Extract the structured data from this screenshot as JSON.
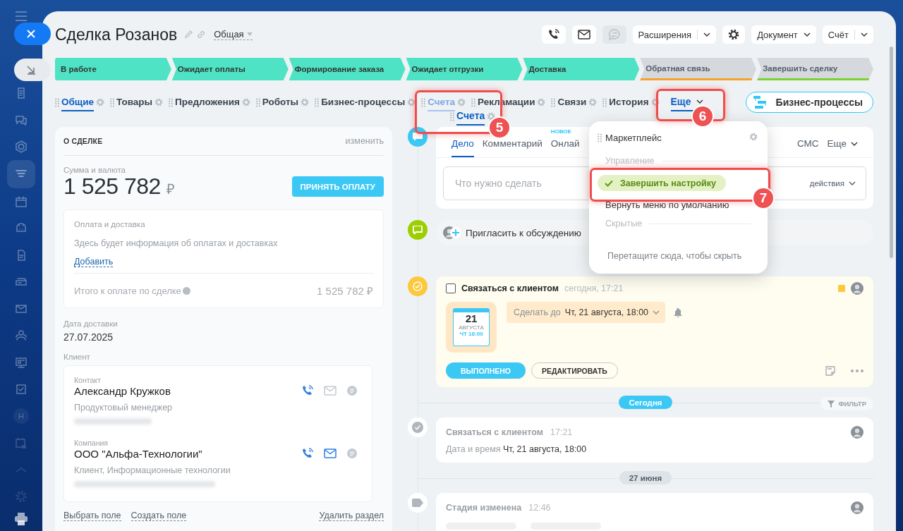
{
  "sidebar": {
    "badge": "H"
  },
  "title": "Сделка Розанов",
  "category": "Общая",
  "header_buttons": [
    {
      "kind": "phone",
      "disabled": false
    },
    {
      "kind": "mail",
      "disabled": false
    },
    {
      "kind": "chat",
      "disabled": true
    },
    {
      "kind": "split",
      "label": "Расширения",
      "disabled": false
    },
    {
      "kind": "settings",
      "disabled": false
    },
    {
      "kind": "dropdown",
      "label": "Документ",
      "disabled": false
    },
    {
      "kind": "split",
      "label": "Счёт",
      "disabled": false
    }
  ],
  "stages": [
    {
      "label": "В работе",
      "reached": true,
      "color": "#4ee3c4"
    },
    {
      "label": "Ожидает оплаты",
      "reached": true,
      "color": "#4ee3c4"
    },
    {
      "label": "Формирование заказа",
      "reached": true,
      "color": "#4ee3c4"
    },
    {
      "label": "Ожидает отгрузки",
      "reached": true,
      "color": "#4ee3c4"
    },
    {
      "label": "Доставка",
      "reached": true,
      "color": "#4ee3c4"
    },
    {
      "label": "Обратная связь",
      "reached": false,
      "color": "#f7a12b"
    },
    {
      "label": "Завершить сделку",
      "reached": false,
      "color": "#7bd12f"
    }
  ],
  "tabs": [
    {
      "label": "Общие",
      "selected": true,
      "dragging": false
    },
    {
      "label": "Товары",
      "selected": false,
      "dragging": false
    },
    {
      "label": "Предложения",
      "selected": false,
      "dragging": false
    },
    {
      "label": "Роботы",
      "selected": false,
      "dragging": false
    },
    {
      "label": "Бизнес-процессы",
      "selected": false,
      "dragging": false
    },
    {
      "label": "Счета",
      "selected": false,
      "dragging": true
    },
    {
      "label": "Рекламации",
      "selected": false,
      "dragging": false
    },
    {
      "label": "Связи",
      "selected": false,
      "dragging": false
    },
    {
      "label": "История",
      "selected": false,
      "dragging": false
    }
  ],
  "drag_ghost": "Счета",
  "more_tab": {
    "label": "Еще",
    "open": true
  },
  "bp_button": "Бизнес-процессы",
  "deal": {
    "title": "О СДЕЛКЕ",
    "edit": "изменить",
    "amount_label": "Сумма и валюта",
    "amount": "1 525 782",
    "currency": "₽",
    "pay_button": "ПРИНЯТЬ ОПЛАТУ",
    "payment": {
      "title": "Оплата и доставка",
      "text": "Здесь будет информация об оплатах и доставках",
      "add": "Добавить",
      "total_label": "Итого к оплате по сделке",
      "total": "1 525 782 ₽"
    },
    "delivery_label": "Дата доставки",
    "delivery": "27.07.2025",
    "client_label": "Клиент",
    "contacts": [
      {
        "type_label": "Контакт",
        "name": "Александр Кружков",
        "role": "Продуктовый менеджер",
        "email_active": false
      },
      {
        "type_label": "Компания",
        "name": "ООО \"Альфа-Технологии\"",
        "role": "Клиент, Информационные технологии",
        "email_active": true
      }
    ],
    "footer_links": [
      "Выбрать поле",
      "Создать поле"
    ],
    "delete_link": "Удалить раздел"
  },
  "activity": {
    "tabs": [
      {
        "label": "Дело",
        "selected": true,
        "caret": false
      },
      {
        "label": "Комментарий",
        "selected": false,
        "caret": false
      },
      {
        "label": "Онлай",
        "selected": false,
        "badge": "НОВОЕ",
        "caret": false
      },
      {
        "label": "СМС",
        "selected": false,
        "caret": false
      },
      {
        "label": "Еще",
        "selected": false,
        "caret": true
      }
    ],
    "placeholder": "Что нужно сделать",
    "actions": "действия"
  },
  "invite": "Пригласить к обсуждению",
  "task": {
    "title": "Связаться с клиентом",
    "time": "сегодня, 17:21",
    "checked": false,
    "cal_day": "21",
    "cal_month": "АВГУСТА",
    "cal_time": "ЧТ 18:00",
    "deadline_label": "Сделать до",
    "deadline": "Чт, 21 августа, 18:00",
    "done_button": "ВЫПОЛНЕНО",
    "edit_button": "РЕДАКТИРОВАТЬ"
  },
  "filter": "ФИЛЬТР",
  "history": [
    {
      "kind": "separator",
      "label": "Сегодня",
      "today": true
    },
    {
      "kind": "done",
      "title": "Связаться с клиентом",
      "time": "17:21",
      "detail_label": "Дата и время",
      "detail": "Чт, 21 августа, 18:00"
    },
    {
      "kind": "separator",
      "label": "27 июня",
      "today": false
    },
    {
      "kind": "stage",
      "title": "Стадия изменена",
      "time": "12:46"
    }
  ],
  "menu": [
    {
      "kind": "item",
      "label": "Маркетплейс"
    },
    {
      "kind": "section",
      "label": "Управление"
    },
    {
      "kind": "action",
      "label": "Завершить настройку"
    },
    {
      "kind": "plain",
      "label": "Вернуть меню по умолчанию"
    },
    {
      "kind": "section",
      "label": "Скрытые"
    },
    {
      "kind": "hint",
      "label": "Перетащите сюда, чтобы скрыть"
    }
  ],
  "callouts": [
    "5",
    "6",
    "7"
  ]
}
